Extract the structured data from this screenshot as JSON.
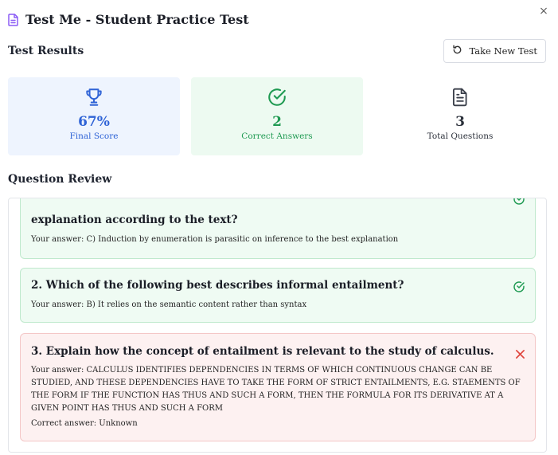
{
  "window": {
    "title": "Test Me - Student Practice Test",
    "close_glyph": "×"
  },
  "results": {
    "heading": "Test Results",
    "new_test_label": "Take New Test"
  },
  "stats": {
    "score": {
      "value": "67%",
      "label": "Final Score",
      "icon": "trophy-icon"
    },
    "correct": {
      "value": "2",
      "label": "Correct Answers",
      "icon": "check-circle-icon"
    },
    "total": {
      "value": "3",
      "label": "Total Questions",
      "icon": "document-icon"
    }
  },
  "review": {
    "heading": "Question Review",
    "questions": [
      {
        "text": "explanation according to the text?",
        "answer": "Your answer: C) Induction by enumeration is parasitic on inference to the best explanation",
        "status": "correct"
      },
      {
        "text": "2. Which of the following best describes informal entailment?",
        "answer": "Your answer: B) It relies on the semantic content rather than syntax",
        "status": "correct"
      },
      {
        "text": "3. Explain how the concept of entailment is relevant to the study of calculus.",
        "answer": "Your answer: CALCULUS IDENTIFIES DEPENDENCIES IN TERMS OF WHICH CONTINUOUS CHANGE CAN BE STUDIED, AND THESE DEPENDENCIES HAVE TO TAKE THE FORM OF STRICT ENTAILMENTS, E.G. STAEMENTS OF THE FORM IF THE FUNCTION HAS THUS AND SUCH A FORM, THEN THE FORMULA FOR ITS DERIVATIVE AT A GIVEN POINT HAS THUS AND SUCH A FORM",
        "correct_answer": "Correct answer: Unknown",
        "status": "incorrect"
      }
    ]
  },
  "colors": {
    "blue": "#2f63d6",
    "green": "#1f9a52",
    "red": "#e0473f",
    "purple": "#8b5cf6"
  }
}
